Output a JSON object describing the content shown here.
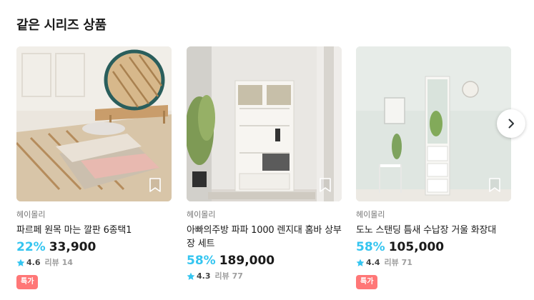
{
  "section": {
    "title": "같은 시리즈 상품"
  },
  "products": [
    {
      "brand": "헤이몰리",
      "name": "파르페 원목 마는 깔판 6종택1",
      "discount": "22%",
      "price": "33,900",
      "rating": "4.6",
      "reviews": "리뷰 14",
      "badge": "특가"
    },
    {
      "brand": "헤이몰리",
      "name": "아빠의주방 파파 1000 렌지대 홈바 상부장 세트",
      "discount": "58%",
      "price": "189,000",
      "rating": "4.3",
      "reviews": "리뷰 77"
    },
    {
      "brand": "헤이몰리",
      "name": "도노 스탠딩 틈새 수납장 거울 화장대",
      "discount": "58%",
      "price": "105,000",
      "rating": "4.4",
      "reviews": "리뷰 71",
      "badge": "특가"
    }
  ],
  "icons": {
    "star": "star-icon",
    "bookmark": "bookmark-icon",
    "next": "chevron-right-icon"
  },
  "colors": {
    "accent": "#35c5f0",
    "badge": "#ff7777"
  }
}
